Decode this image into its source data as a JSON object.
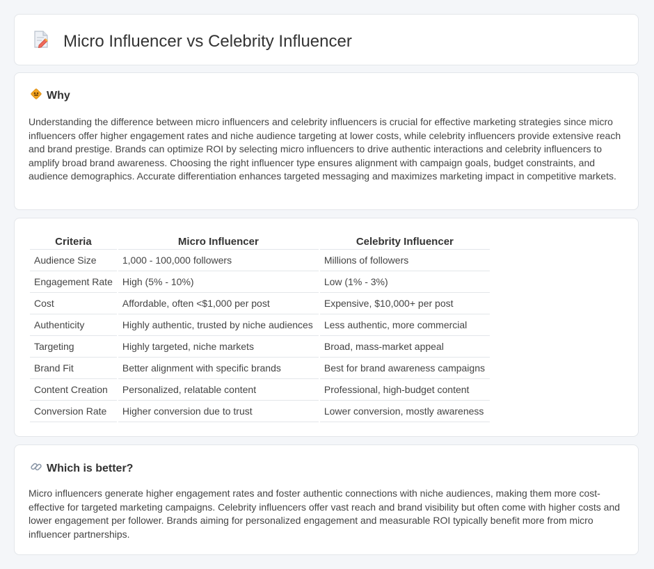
{
  "header": {
    "title": "Micro Influencer vs Celebrity Influencer",
    "icon": "document-pencil-icon"
  },
  "why": {
    "title": "Why",
    "icon": "diamond-sign-icon",
    "text": "Understanding the difference between micro influencers and celebrity influencers is crucial for effective marketing strategies since micro influencers offer higher engagement rates and niche audience targeting at lower costs, while celebrity influencers provide extensive reach and brand prestige. Brands can optimize ROI by selecting micro influencers to drive authentic interactions and celebrity influencers to amplify broad brand awareness. Choosing the right influencer type ensures alignment with campaign goals, budget constraints, and audience demographics. Accurate differentiation enhances targeted messaging and maximizes marketing impact in competitive markets."
  },
  "table": {
    "headers": [
      "Criteria",
      "Micro Influencer",
      "Celebrity Influencer"
    ],
    "rows": [
      [
        "Audience Size",
        "1,000 - 100,000 followers",
        "Millions of followers"
      ],
      [
        "Engagement Rate",
        "High (5% - 10%)",
        "Low (1% - 3%)"
      ],
      [
        "Cost",
        "Affordable, often <$1,000 per post",
        "Expensive, $10,000+ per post"
      ],
      [
        "Authenticity",
        "Highly authentic, trusted by niche audiences",
        "Less authentic, more commercial"
      ],
      [
        "Targeting",
        "Highly targeted, niche markets",
        "Broad, mass-market appeal"
      ],
      [
        "Brand Fit",
        "Better alignment with specific brands",
        "Best for brand awareness campaigns"
      ],
      [
        "Content Creation",
        "Personalized, relatable content",
        "Professional, high-budget content"
      ],
      [
        "Conversion Rate",
        "Higher conversion due to trust",
        "Lower conversion, mostly awareness"
      ]
    ]
  },
  "better": {
    "title": "Which is better?",
    "icon": "link-icon",
    "text": "Micro influencers generate higher engagement rates and foster authentic connections with niche audiences, making them more cost-effective for targeted marketing campaigns. Celebrity influencers offer vast reach and brand visibility but often come with higher costs and lower engagement per follower. Brands aiming for personalized engagement and measurable ROI typically benefit more from micro influencer partnerships."
  },
  "colors": {
    "background": "#f4f6f9",
    "card": "#ffffff",
    "border": "#e3e6ea",
    "accent": "#f0a030"
  }
}
